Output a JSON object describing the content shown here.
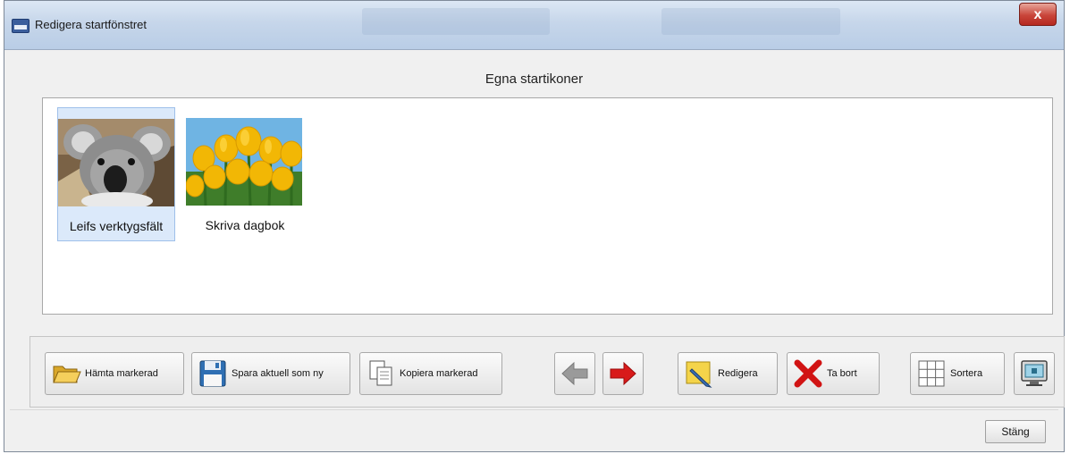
{
  "window": {
    "title": "Redigera startfönstret",
    "close_glyph": "x"
  },
  "panel": {
    "heading": "Egna startikoner",
    "tiles": [
      {
        "label": "Leifs verktygsfält",
        "image": "koala-photo",
        "selected": true
      },
      {
        "label": "Skriva dagbok",
        "image": "tulips-photo",
        "selected": false
      }
    ]
  },
  "toolbar": {
    "fetch_label": "Hämta markerad",
    "save_label": "Spara aktuell som ny",
    "copy_label": "Kopiera markerad",
    "prev_icon": "arrow-left-icon",
    "next_icon": "arrow-right-icon",
    "edit_label": "Redigera",
    "delete_label": "Ta bort",
    "sort_label": "Sortera",
    "screen_icon": "monitor-icon"
  },
  "footer": {
    "close_label": "Stäng"
  },
  "colors": {
    "selection": "#dbe9fa",
    "delete_red": "#d11414",
    "arrow_red": "#d81a1a",
    "arrow_gray": "#9a9a9a"
  }
}
